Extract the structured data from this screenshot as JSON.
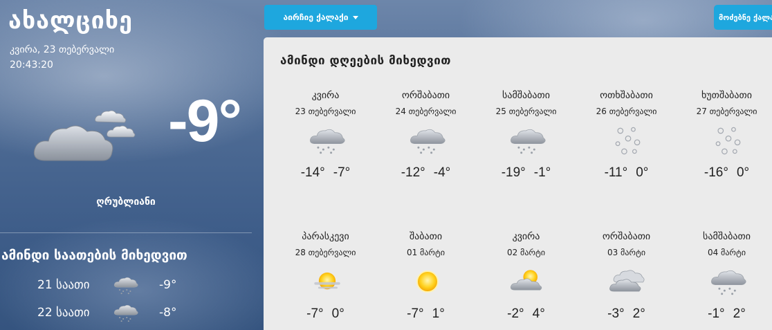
{
  "current": {
    "city": "ახალციხე",
    "date": "კვირა, 23 თებერვალი",
    "time": "20:43:20",
    "temperature": "-9°",
    "condition": "ღრუბლიანი",
    "icon": "cloudy-icon"
  },
  "hourly": {
    "title": "ამინდი საათების მიხედვით",
    "items": [
      {
        "label": "21 საათი",
        "icon": "snow-cloud-icon",
        "temp": "-9°"
      },
      {
        "label": "22 საათი",
        "icon": "snow-cloud-icon",
        "temp": "-8°"
      }
    ]
  },
  "nav": {
    "choose_city": "აირჩიე ქალაქი",
    "search": "მოძებნე ქალაქი"
  },
  "daily": {
    "title": "ამინდი დღეების მიხედვით",
    "days": [
      {
        "name": "კვირა",
        "date": "23 თებერვალი",
        "icon": "snow-cloud-icon",
        "min": "-14°",
        "max": "-7°"
      },
      {
        "name": "ორშაბათი",
        "date": "24 თებერვალი",
        "icon": "snow-cloud-icon",
        "min": "-12°",
        "max": "-4°"
      },
      {
        "name": "სამშაბათი",
        "date": "25 თებერვალი",
        "icon": "snow-cloud-icon",
        "min": "-19°",
        "max": "-1°"
      },
      {
        "name": "ოთხშაბათი",
        "date": "26 თებერვალი",
        "icon": "snowflakes-icon",
        "min": "-11°",
        "max": "0°"
      },
      {
        "name": "ხუთშაბათი",
        "date": "27 თებერვალი",
        "icon": "snowflakes-icon",
        "min": "-16°",
        "max": "0°"
      },
      {
        "name": "პარასკევი",
        "date": "28 თებერვალი",
        "icon": "sun-haze-icon",
        "min": "-7°",
        "max": "0°"
      },
      {
        "name": "შაბათი",
        "date": "01 მარტი",
        "icon": "sun-icon",
        "min": "-7°",
        "max": "1°"
      },
      {
        "name": "კვირა",
        "date": "02 მარტი",
        "icon": "partly-cloudy-icon",
        "min": "-2°",
        "max": "4°"
      },
      {
        "name": "ორშაბათი",
        "date": "03 მარტი",
        "icon": "overcast-icon",
        "min": "-3°",
        "max": "2°"
      },
      {
        "name": "სამშაბათი",
        "date": "04 მარტი",
        "icon": "snow-cloud-icon",
        "min": "-1°",
        "max": "2°"
      }
    ]
  },
  "colors": {
    "accent": "#1ea7de",
    "panel": "#ebebeb"
  }
}
